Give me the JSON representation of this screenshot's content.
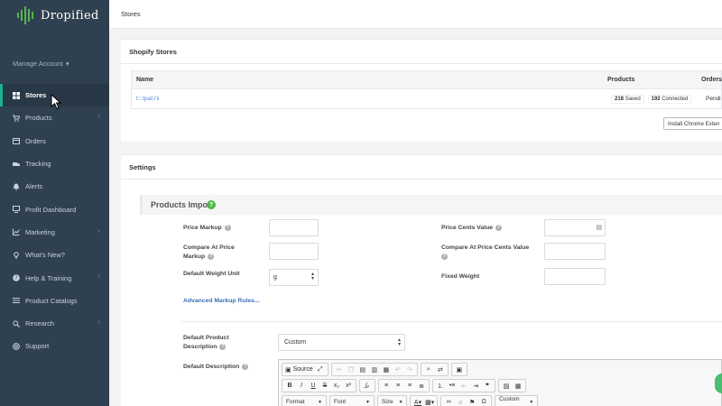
{
  "app": {
    "logo_text": "Dropified",
    "manage_account": "Manage Account"
  },
  "sidebar": {
    "items": [
      {
        "label": "Stores",
        "icon": "grid-icon",
        "active": true,
        "has_chevron": false
      },
      {
        "label": "Products",
        "icon": "cart-icon",
        "active": false,
        "has_chevron": true
      },
      {
        "label": "Orders",
        "icon": "calendar-icon",
        "active": false,
        "has_chevron": false
      },
      {
        "label": "Tracking",
        "icon": "truck-icon",
        "active": false,
        "has_chevron": false
      },
      {
        "label": "Alerts",
        "icon": "bell-icon",
        "active": false,
        "has_chevron": false
      },
      {
        "label": "Profit Dashboard",
        "icon": "monitor-icon",
        "active": false,
        "has_chevron": false
      },
      {
        "label": "Marketing",
        "icon": "chart-icon",
        "active": false,
        "has_chevron": true
      },
      {
        "label": "What's New?",
        "icon": "bulb-icon",
        "active": false,
        "has_chevron": false
      },
      {
        "label": "Help & Training",
        "icon": "question-icon",
        "active": false,
        "has_chevron": true
      },
      {
        "label": "Product Catalogs",
        "icon": "list-icon",
        "active": false,
        "has_chevron": false
      },
      {
        "label": "Research",
        "icon": "search-icon",
        "active": false,
        "has_chevron": true
      },
      {
        "label": "Support",
        "icon": "lifebuoy-icon",
        "active": false,
        "has_chevron": false
      }
    ]
  },
  "breadcrumb": "Stores",
  "stores_panel": {
    "title": "Shopify Stores",
    "columns": {
      "name": "Name",
      "products": "Products",
      "orders": "Orders"
    },
    "row": {
      "store_name": "t:::tpat:i'ii",
      "saved_count": "218",
      "saved_label": "Saved",
      "connected_count": "192",
      "connected_label": "Connected",
      "orders_status": "Pendi"
    },
    "extension_button": "Install Chrome Exten"
  },
  "settings_panel": {
    "title": "Settings",
    "section_title": "Products Impo",
    "fields": {
      "price_markup": "Price Markup",
      "price_cents_value": "Price Cents Value",
      "compare_price_markup": "Compare At Price Markup",
      "compare_cents_value": "Compare At Price Cents Value",
      "default_weight_unit": "Default Weight Unit",
      "weight_unit_value": "g",
      "fixed_weight": "Fixed Weight",
      "advanced_markup_link": "Advanced Markup Rules...",
      "default_product_description": "Default Product Description",
      "description_select_value": "Custom",
      "default_description": "Default Description"
    },
    "editor": {
      "source_label": "Source",
      "combos": {
        "format": "Format",
        "font": "Font",
        "size": "Size",
        "custom": "Custom ..."
      }
    }
  },
  "colors": {
    "sidebar_bg": "#2f4050",
    "accent": "#1ab394",
    "link": "#3d6fb8"
  }
}
